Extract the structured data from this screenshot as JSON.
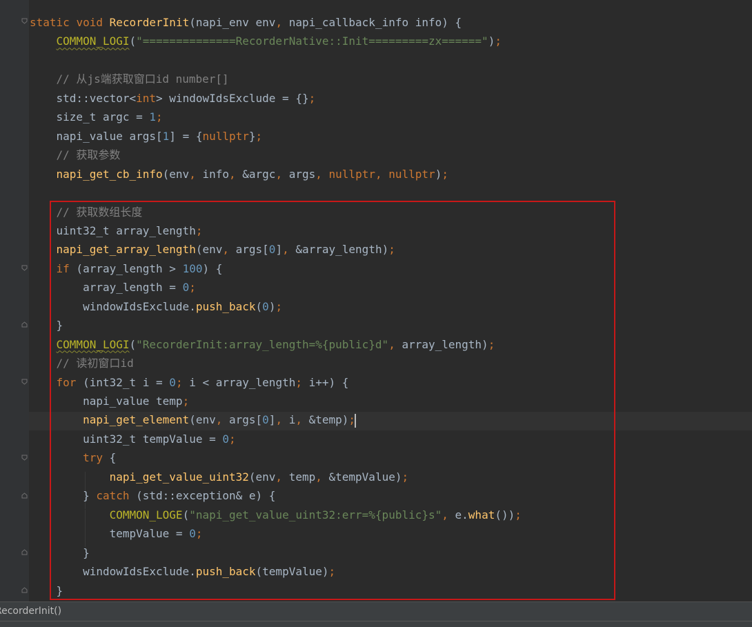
{
  "editor": {
    "language": "C++",
    "theme": "Darcula",
    "lines": [
      "static void RecorderInit(napi_env env, napi_callback_info info) {",
      "    COMMON_LOGI(\"==============RecorderNative::Init=========zx======\");",
      "",
      "    // 从js端获取窗口id number[]",
      "    std::vector<int> windowIdsExclude = {};",
      "    size_t argc = 1;",
      "    napi_value args[1] = {nullptr};",
      "    // 获取参数",
      "    napi_get_cb_info(env, info, &argc, args, nullptr, nullptr);",
      "",
      "    // 获取数组长度",
      "    uint32_t array_length;",
      "    napi_get_array_length(env, args[0], &array_length);",
      "    if (array_length > 100) {",
      "        array_length = 0;",
      "        windowIdsExclude.push_back(0);",
      "    }",
      "    COMMON_LOGI(\"RecorderInit:array_length=%{public}d\", array_length);",
      "    // 读初窗口id",
      "    for (int32_t i = 0; i < array_length; i++) {",
      "        napi_value temp;",
      "        napi_get_element(env, args[0], i, &temp);",
      "        uint32_t tempValue = 0;",
      "        try {",
      "            napi_get_value_uint32(env, temp, &tempValue);",
      "        } catch (std::exception& e) {",
      "            COMMON_LOGE(\"napi_get_value_uint32:err=%{public}s\", e.what());",
      "            tempValue = 0;",
      "        }",
      "        windowIdsExclude.push_back(tempValue);",
      "    }"
    ],
    "current_line": 21,
    "highlight_color": "#c81818"
  },
  "status_bar": {
    "breadcrumb": "RecorderInit()"
  }
}
